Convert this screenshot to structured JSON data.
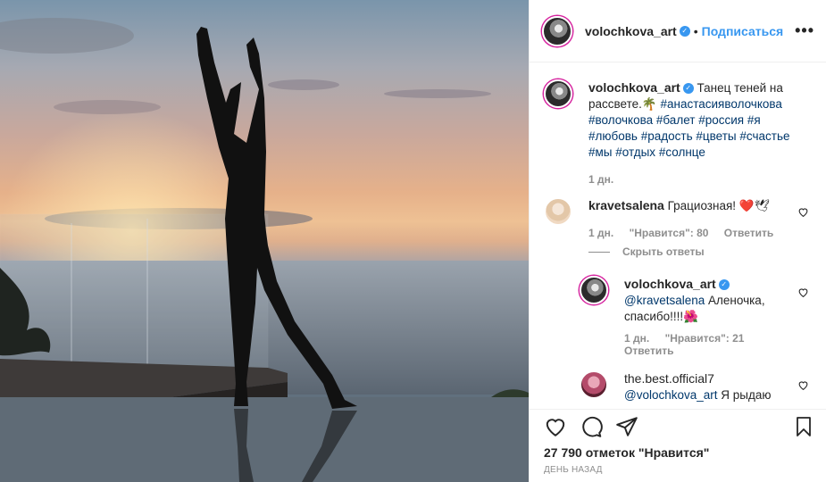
{
  "post": {
    "author": "volochkova_art",
    "follow_label": "Подписаться",
    "more_label": "•••",
    "separator": "•"
  },
  "caption": {
    "author": "volochkova_art",
    "text": "Танец теней на рассвете.",
    "emoji": "🌴",
    "hashtags": [
      "#анастасияволочкова",
      "#волочкова",
      "#балет",
      "#россия",
      "#я",
      "#любовь",
      "#радость",
      "#цветы",
      "#счастье",
      "#мы",
      "#отдых",
      "#солнце"
    ],
    "time": "1 дн."
  },
  "comments": [
    {
      "author": "kravetsalena",
      "text": "Грациозная!",
      "emoji": "❤️🕊",
      "time": "1 дн.",
      "likes": "\"Нравится\": 80",
      "reply_label": "Ответить",
      "hide_replies": "Скрыть ответы"
    },
    {
      "author": "volochkova_art",
      "mention": "@kravetsalena",
      "text": "Аленочка, спасибо!!!!",
      "emoji": "🌺",
      "time": "1 дн.",
      "likes": "\"Нравится\": 21",
      "reply_label": "Ответить"
    },
    {
      "author": "the.best.official7",
      "mention": "@volochkova_art",
      "text": "Я рыдаю"
    }
  ],
  "footer": {
    "likes": "27 790 отметок \"Нравится\"",
    "date": "ДЕНЬ НАЗАД"
  },
  "icons": {
    "heart": "heart-icon",
    "comment": "comment-icon",
    "share": "share-icon",
    "bookmark": "bookmark-icon",
    "verified": "verified-badge-icon"
  },
  "colors": {
    "link": "#3897f0",
    "hashtag": "#00376b",
    "muted": "#8e8e8e",
    "border": "#efefef"
  }
}
